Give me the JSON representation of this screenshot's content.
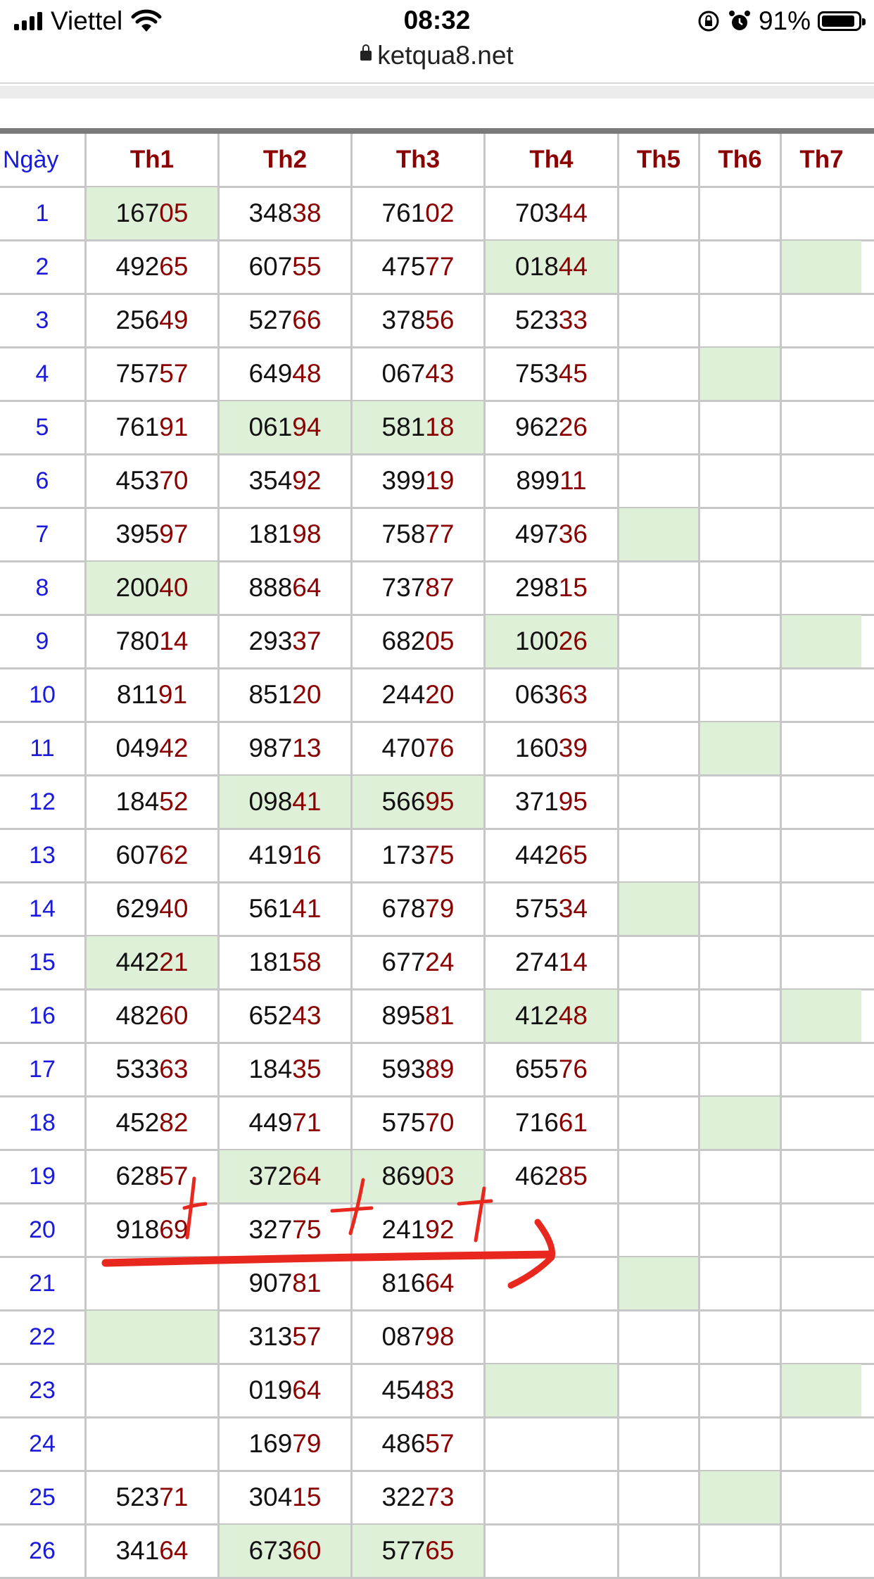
{
  "status_bar": {
    "carrier": "Viettel",
    "time": "08:32",
    "battery": "91%",
    "icons": [
      "signal-icon",
      "wifi-icon",
      "rotation-lock-icon",
      "alarm-icon",
      "battery-icon"
    ]
  },
  "browser": {
    "url": "ketqua8.net"
  },
  "table": {
    "day_header": "Ngày",
    "columns": [
      "Th1",
      "Th2",
      "Th3",
      "Th4",
      "Th5",
      "Th6",
      "Th7"
    ],
    "rows": [
      {
        "day": "1",
        "cells": [
          "16705",
          "34838",
          "76102",
          "70344",
          "",
          "",
          ""
        ],
        "highlight": [
          0
        ]
      },
      {
        "day": "2",
        "cells": [
          "49265",
          "60755",
          "47577",
          "01844",
          "",
          "",
          ""
        ],
        "highlight": [
          3,
          6
        ]
      },
      {
        "day": "3",
        "cells": [
          "25649",
          "52766",
          "37856",
          "52333",
          "",
          "",
          ""
        ],
        "highlight": []
      },
      {
        "day": "4",
        "cells": [
          "75757",
          "64948",
          "06743",
          "75345",
          "",
          "",
          ""
        ],
        "highlight": [
          5
        ]
      },
      {
        "day": "5",
        "cells": [
          "76191",
          "06194",
          "58118",
          "96226",
          "",
          "",
          ""
        ],
        "highlight": [
          1,
          2
        ]
      },
      {
        "day": "6",
        "cells": [
          "45370",
          "35492",
          "39919",
          "89911",
          "",
          "",
          ""
        ],
        "highlight": []
      },
      {
        "day": "7",
        "cells": [
          "39597",
          "18198",
          "75877",
          "49736",
          "",
          "",
          ""
        ],
        "highlight": [
          4
        ]
      },
      {
        "day": "8",
        "cells": [
          "20040",
          "88864",
          "73787",
          "29815",
          "",
          "",
          ""
        ],
        "highlight": [
          0
        ]
      },
      {
        "day": "9",
        "cells": [
          "78014",
          "29337",
          "68205",
          "10026",
          "",
          "",
          ""
        ],
        "highlight": [
          3,
          6
        ]
      },
      {
        "day": "10",
        "cells": [
          "81191",
          "85120",
          "24420",
          "06363",
          "",
          "",
          ""
        ],
        "highlight": []
      },
      {
        "day": "11",
        "cells": [
          "04942",
          "98713",
          "47076",
          "16039",
          "",
          "",
          ""
        ],
        "highlight": [
          5
        ]
      },
      {
        "day": "12",
        "cells": [
          "18452",
          "09841",
          "56695",
          "37195",
          "",
          "",
          ""
        ],
        "highlight": [
          1,
          2
        ]
      },
      {
        "day": "13",
        "cells": [
          "60762",
          "41916",
          "17375",
          "44265",
          "",
          "",
          ""
        ],
        "highlight": []
      },
      {
        "day": "14",
        "cells": [
          "62940",
          "56141",
          "67879",
          "57534",
          "",
          "",
          ""
        ],
        "highlight": [
          4
        ]
      },
      {
        "day": "15",
        "cells": [
          "44221",
          "18158",
          "67724",
          "27414",
          "",
          "",
          ""
        ],
        "highlight": [
          0
        ]
      },
      {
        "day": "16",
        "cells": [
          "48260",
          "65243",
          "89581",
          "41248",
          "",
          "",
          ""
        ],
        "highlight": [
          3,
          6
        ]
      },
      {
        "day": "17",
        "cells": [
          "53363",
          "18435",
          "59389",
          "65576",
          "",
          "",
          ""
        ],
        "highlight": []
      },
      {
        "day": "18",
        "cells": [
          "45282",
          "44971",
          "57570",
          "71661",
          "",
          "",
          ""
        ],
        "highlight": [
          5
        ]
      },
      {
        "day": "19",
        "cells": [
          "62857",
          "37264",
          "86903",
          "46285",
          "",
          "",
          ""
        ],
        "highlight": [
          1,
          2
        ]
      },
      {
        "day": "20",
        "cells": [
          "91869",
          "32775",
          "24192",
          "",
          "",
          "",
          ""
        ],
        "highlight": []
      },
      {
        "day": "21",
        "cells": [
          "",
          "90781",
          "81664",
          "",
          "",
          "",
          ""
        ],
        "highlight": [
          4
        ]
      },
      {
        "day": "22",
        "cells": [
          "",
          "31357",
          "08798",
          "",
          "",
          "",
          ""
        ],
        "highlight": [
          0
        ]
      },
      {
        "day": "23",
        "cells": [
          "",
          "01964",
          "45483",
          "",
          "",
          "",
          ""
        ],
        "highlight": [
          3,
          6
        ]
      },
      {
        "day": "24",
        "cells": [
          "",
          "16979",
          "48657",
          "",
          "",
          "",
          ""
        ],
        "highlight": []
      },
      {
        "day": "25",
        "cells": [
          "52371",
          "30415",
          "32273",
          "",
          "",
          "",
          ""
        ],
        "highlight": [
          5
        ]
      },
      {
        "day": "26",
        "cells": [
          "34164",
          "67360",
          "57765",
          "",
          "",
          "",
          ""
        ],
        "highlight": [
          1,
          2
        ]
      }
    ]
  },
  "annotation": {
    "color": "#e8281e",
    "marks": [
      "plus-mark",
      "plus-mark",
      "plus-mark",
      "arrow"
    ]
  }
}
